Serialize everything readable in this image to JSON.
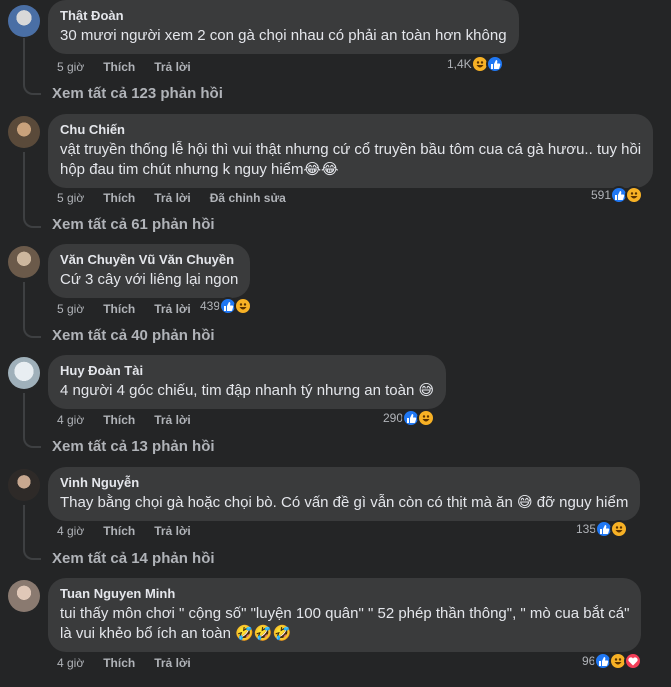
{
  "comments": [
    {
      "author": "Thật Đoàn",
      "lines": [
        "30 mươi người xem 2 con gà chọi nhau có phải an toàn hơn không"
      ],
      "emoji": "",
      "time": "5 giờ",
      "like": "Thích",
      "reply": "Trả lời",
      "edited": "",
      "reaction_count": "1,4K",
      "reaction_icons": [
        "haha-icon",
        "like-icon"
      ],
      "view_replies": "Xem tất cả 123 phản hồi"
    },
    {
      "author": "Chu Chiến",
      "lines": [
        "vật truyền thống lễ hội thì vui thật nhưng cứ cổ truyền bầu tôm cua cá gà hươu.. tuy hồi",
        "hộp đau tim chút nhưng k nguy hiểm"
      ],
      "emoji": "😂😂",
      "time": "5 giờ",
      "like": "Thích",
      "reply": "Trả lời",
      "edited": "Đã chỉnh sửa",
      "reaction_count": "591",
      "reaction_icons": [
        "like-icon",
        "haha-icon"
      ],
      "view_replies": "Xem tất cả 61 phản hồi"
    },
    {
      "author": "Văn Chuyền Vũ Văn Chuyền",
      "lines": [
        "Cứ 3 cây với liêng lại ngon"
      ],
      "emoji": "",
      "time": "5 giờ",
      "like": "Thích",
      "reply": "Trả lời",
      "edited": "",
      "reaction_count": "439",
      "reaction_icons": [
        "like-icon",
        "haha-icon"
      ],
      "view_replies": "Xem tất cả 40 phản hồi"
    },
    {
      "author": "Huy Đoàn Tài",
      "lines": [
        "4 người 4 góc chiếu, tim đập nhanh tý nhưng an toàn"
      ],
      "emoji": "😅",
      "time": "4 giờ",
      "like": "Thích",
      "reply": "Trả lời",
      "edited": "",
      "reaction_count": "290",
      "reaction_icons": [
        "like-icon",
        "haha-icon"
      ],
      "view_replies": "Xem tất cả 13 phản hồi"
    },
    {
      "author": "Vinh Nguyễn",
      "lines": [
        "Thay bằng chọi gà hoặc chọi bò. Có vấn đề gì vẫn còn có thịt mà ăn 😅 đỡ nguy hiểm"
      ],
      "emoji": "",
      "time": "4 giờ",
      "like": "Thích",
      "reply": "Trả lời",
      "edited": "",
      "reaction_count": "135",
      "reaction_icons": [
        "like-icon",
        "haha-icon"
      ],
      "view_replies": "Xem tất cả 14 phản hồi"
    },
    {
      "author": "Tuan Nguyen Minh",
      "lines": [
        "tui thấy môn chơi \" cộng số\" \"luyện 100 quân\" \" 52 phép thần thông\", \" mò cua bắt cá\"",
        "là vui khẻo bổ ích an toàn"
      ],
      "emoji": "🤣🤣🤣",
      "time": "4 giờ",
      "like": "Thích",
      "reply": "Trả lời",
      "edited": "",
      "reaction_count": "96",
      "reaction_icons": [
        "like-icon",
        "haha-icon",
        "love-icon"
      ],
      "view_replies": ""
    }
  ],
  "colors": {
    "background": "#242526",
    "bubble": "#3a3b3c",
    "primary_text": "#e4e6eb",
    "secondary_text": "#b0b3b8",
    "like": "#2078f4",
    "haha": "#f7b125",
    "love": "#f33e58"
  }
}
